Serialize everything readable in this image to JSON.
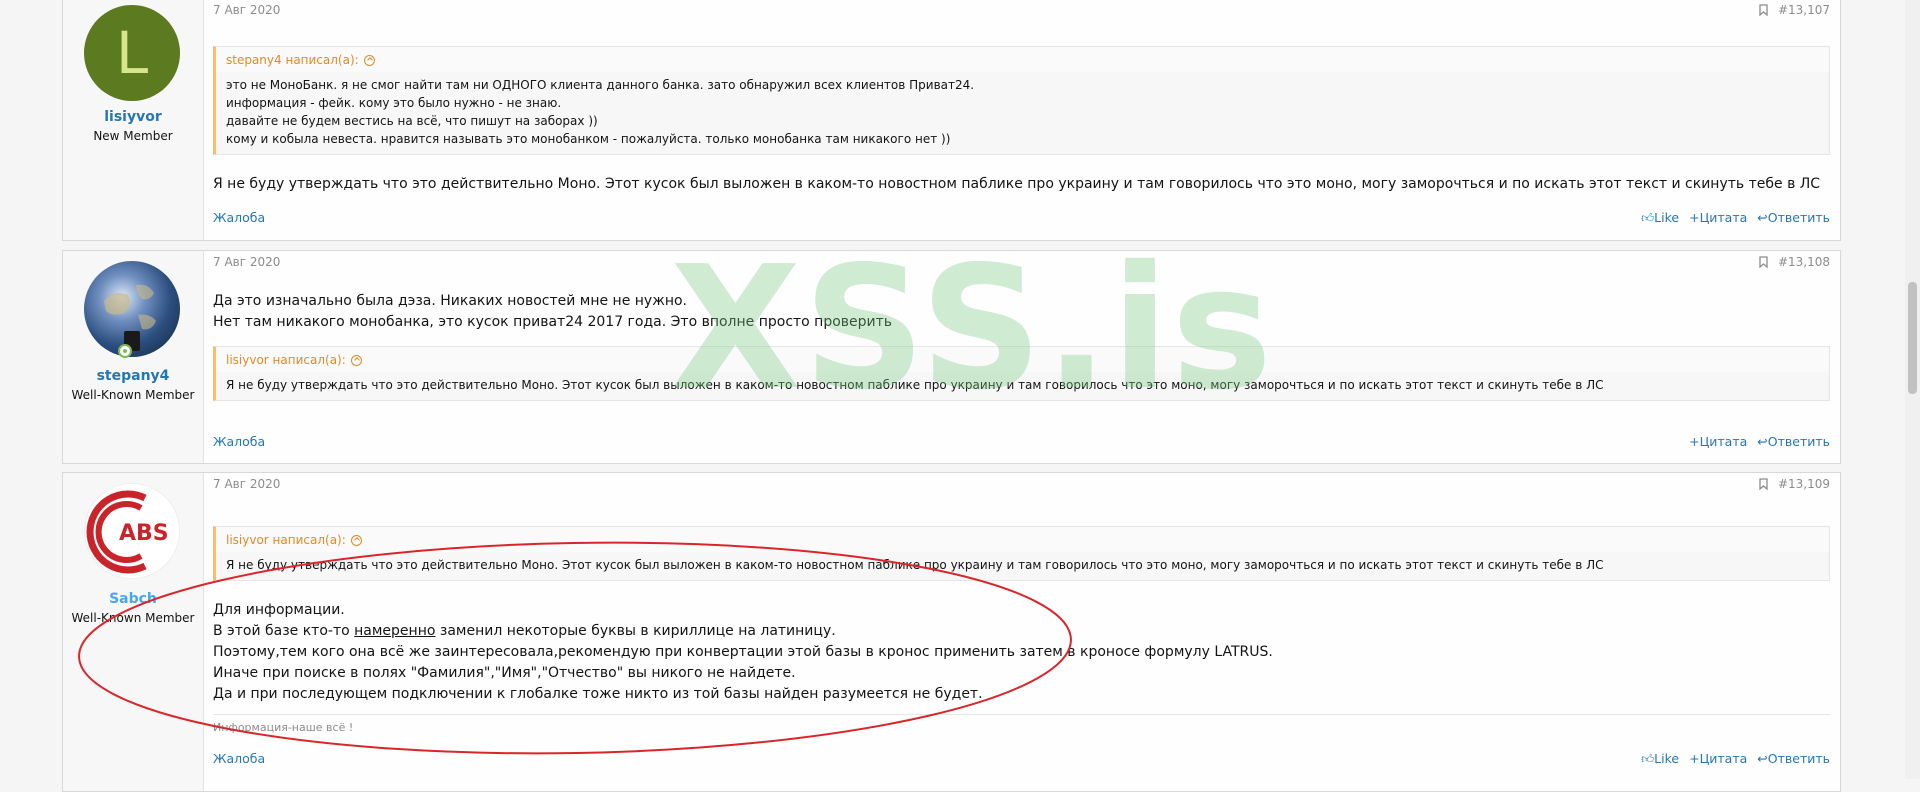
{
  "watermark": "XSS.is",
  "posts": [
    {
      "avatar_letter": "L",
      "username": "lisiyvor",
      "user_title": "New Member",
      "date": "7 Авг 2020",
      "post_number": "#13,107",
      "quote": {
        "author": "stepany4 написал(а):",
        "lines": [
          "это не МоноБанк. я не смог найти там ни ОДНОГО клиента данного банка. зато обнаружил всех клиентов Приват24.",
          "информация - фейк. кому это было нужно - не знаю.",
          "давайте не будем вестись на всё, что пишут на заборах ))",
          "кому и кобыла невеста. нравится называть это монобанком - пожалуйста. только монобанка там никакого нет ))"
        ]
      },
      "message": [
        "Я не буду утверждать что это действительно Моно. Этот кусок был выложен в каком-то новостном паблике про украину и там говорилось что это моно, могу заморочться и по искать этот текст и скинуть тебе в ЛС"
      ],
      "report": "Жалоба",
      "like": "Like",
      "quote_btn": "+Цитата",
      "reply": "Ответить"
    },
    {
      "username": "stepany4",
      "user_title": "Well-Known Member",
      "date": "7 Авг 2020",
      "post_number": "#13,108",
      "message": [
        "Да это изначально была дэза. Никаких новостей мне не нужно.",
        "Нет там никакого монобанка, это кусок приват24 2017 года. Это вполне просто проверить"
      ],
      "quote": {
        "author": "lisiyvor написал(а):",
        "lines": [
          "Я не буду утверждать что это действительно Моно. Этот кусок был выложен в каком-то новостном паблике про украину и там говорилось что это моно, могу заморочться и по искать этот текст и скинуть тебе в ЛС"
        ]
      },
      "report": "Жалоба",
      "quote_btn": "+Цитата",
      "reply": "Ответить"
    },
    {
      "avatar_text": "ABS",
      "username": "Sabch",
      "user_title": "Well-Known Member",
      "date": "7 Авг 2020",
      "post_number": "#13,109",
      "quote": {
        "author": "lisiyvor написал(а):",
        "lines": [
          "Я не буду утверждать что это действительно Моно. Этот кусок был выложен в каком-то новостном паблике про украину и там говорилось что это моно, могу заморочться и по искать этот текст и скинуть тебе в ЛС"
        ]
      },
      "message_line1": "Для информации.",
      "message_line2_pre": "В этой базе кто-то ",
      "message_line2_u": "намеренно",
      "message_line2_post": " заменил некоторые буквы в кириллице на латиницу.",
      "message_line3": "Поэтому,тем кого она всё же заинтересовала,рекомендую при конвертации этой базы в кронос применить затем в кроносе формулу LATRUS.",
      "message_line4": "Иначе при поиске в полях \"Фамилия\",\"Имя\",\"Отчество\" вы никого не найдете.",
      "message_line5": "Да и при последующем подключении к глобалке тоже никто из той базы найден разумеется не будет.",
      "signature": "Информация-наше всё !",
      "report": "Жалоба",
      "like": "Like",
      "quote_btn": "+Цитата",
      "reply": "Ответить"
    }
  ],
  "colors": {
    "link": "#2577b1",
    "quote_author": "#df8a26",
    "annotation": "#d9262a"
  }
}
